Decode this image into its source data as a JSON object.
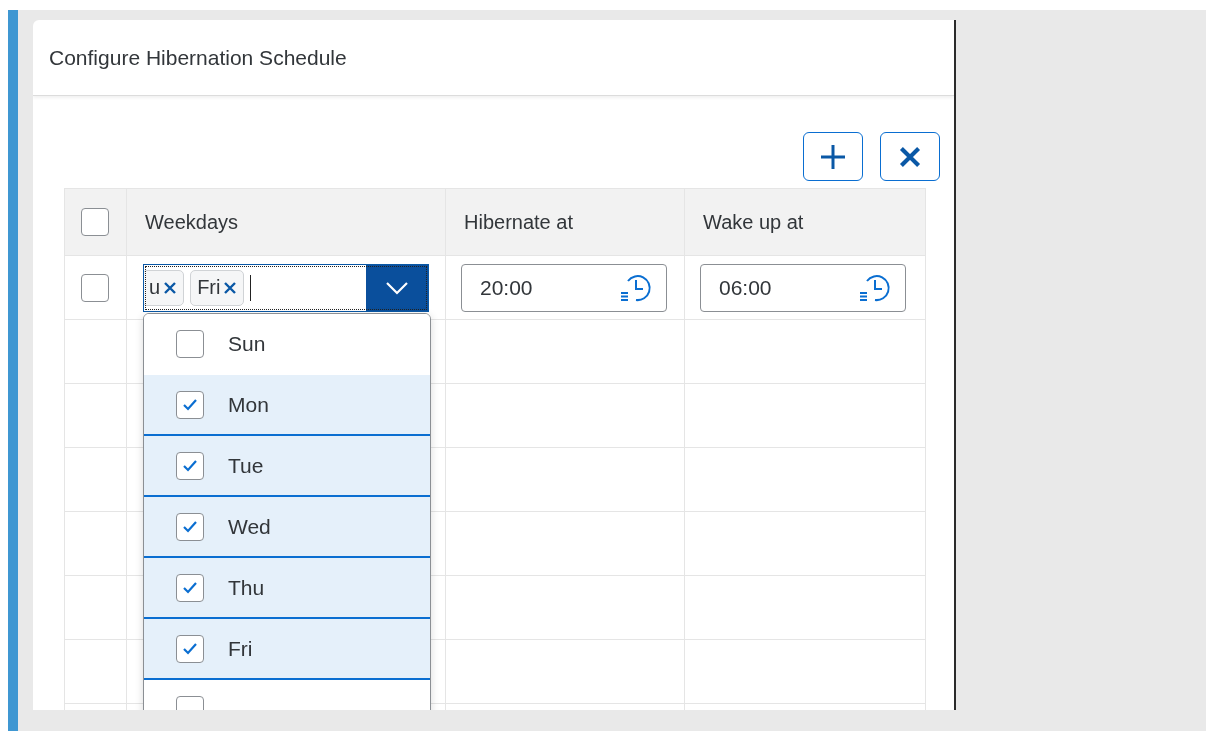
{
  "dialog": {
    "title": "Configure Hibernation Schedule"
  },
  "toolbar": {
    "buttons": [
      {
        "kind": "add"
      },
      {
        "kind": "delete"
      }
    ]
  },
  "table": {
    "header_checkbox": {
      "checked": false
    },
    "columns": [
      "Weekdays",
      "Hibernate at",
      "Wake up at"
    ],
    "rows": [
      {
        "checked": false,
        "weekdays": {
          "tokens": [
            "u",
            "Fri"
          ]
        },
        "hibernate_at": "20:00",
        "wake_up_at": "06:00"
      }
    ]
  },
  "dropdown": {
    "items": [
      {
        "label": "Sun",
        "checked": false
      },
      {
        "label": "Mon",
        "checked": true
      },
      {
        "label": "Tue",
        "checked": true
      },
      {
        "label": "Wed",
        "checked": true
      },
      {
        "label": "Thu",
        "checked": true
      },
      {
        "label": "Fri",
        "checked": true
      },
      {
        "checked": false
      }
    ]
  }
}
